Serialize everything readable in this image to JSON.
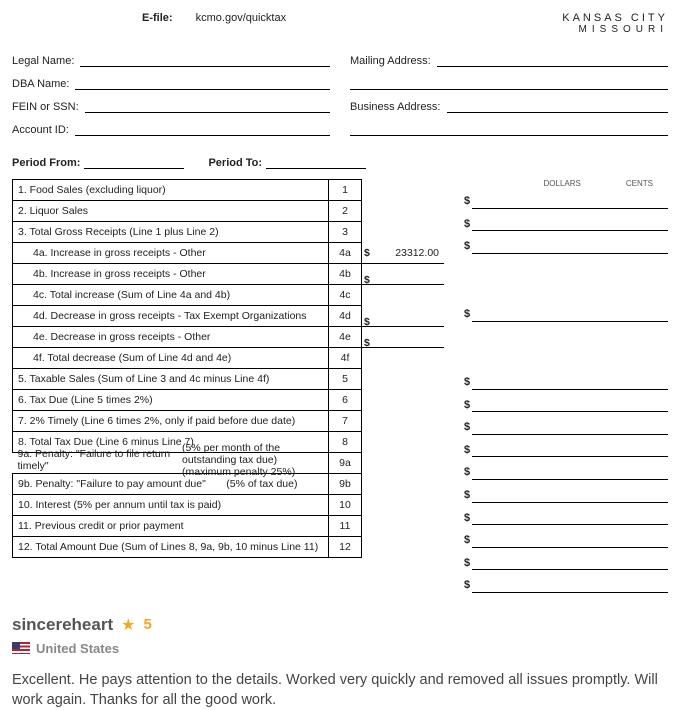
{
  "header": {
    "efile_label": "E-file:",
    "efile_url": "kcmo.gov/quicktax",
    "city_line1": "KANSAS CITY",
    "city_line2": "MISSOURI"
  },
  "fields": {
    "legal_name": "Legal Name:",
    "dba_name": "DBA Name:",
    "fein_ssn": "FEIN or SSN:",
    "account_id": "Account ID:",
    "mailing": "Mailing Address:",
    "business": "Business Address:",
    "period_from": "Period From:",
    "period_to": "Period To:"
  },
  "cols": {
    "dollars": "DOLLARS",
    "cents": "CENTS"
  },
  "rows": {
    "r1": "1. Food Sales   (excluding liquor)",
    "r2": "2. Liquor Sales",
    "r3": "3. Total Gross Receipts   (Line 1 plus Line 2)",
    "r4a": "4a. Increase in gross receipts - Other",
    "r4b": "4b. Increase in gross receipts - Other",
    "r4c": "4c. Total increase   (Sum of Line 4a and 4b)",
    "r4d": "4d. Decrease in gross receipts - Tax Exempt Organizations",
    "r4e": "4e. Decrease in gross receipts - Other",
    "r4f": "4f. Total decrease   (Sum of Line 4d and 4e)",
    "r5": "5. Taxable Sales   (Sum of Line 3 and 4c minus Line 4f)",
    "r6": "6. Tax Due   (Line 5 times 2%)",
    "r7": "7. 2% Timely   (Line 6 times 2%, only if paid before due date)",
    "r8": "8. Total Tax Due   (Line 6 minus Line 7)",
    "r9a_main": "9a. Penalty: \"Failure to file return timely\"",
    "r9a_sub": "(5% per month of the outstanding tax due) (maximum penalty 25%)",
    "r9b_main": "9b. Penalty: \"Failure to pay amount due\"",
    "r9b_sub": "(5% of tax due)",
    "r10": "10. Interest (5% per annum until tax is paid)",
    "r11": "11. Previous credit or prior payment",
    "r12": "12. Total Amount Due   (Sum of Lines 8, 9a, 9b, 10 minus Line 11)"
  },
  "nums": {
    "n1": "1",
    "n2": "2",
    "n3": "3",
    "n4a": "4a",
    "n4b": "4b",
    "n4c": "4c",
    "n4d": "4d",
    "n4e": "4e",
    "n4f": "4f",
    "n5": "5",
    "n6": "6",
    "n7": "7",
    "n8": "8",
    "n9a": "9a",
    "n9b": "9b",
    "n10": "10",
    "n11": "11",
    "n12": "12"
  },
  "values": {
    "v4a": "23312.00"
  },
  "dollar": "$",
  "review": {
    "name": "sincereheart",
    "rating": "5",
    "country": "United States",
    "text": "Excellent. He pays attention to the details. Worked very quickly and removed all issues promptly. Will work again. Thanks for all the good work."
  }
}
